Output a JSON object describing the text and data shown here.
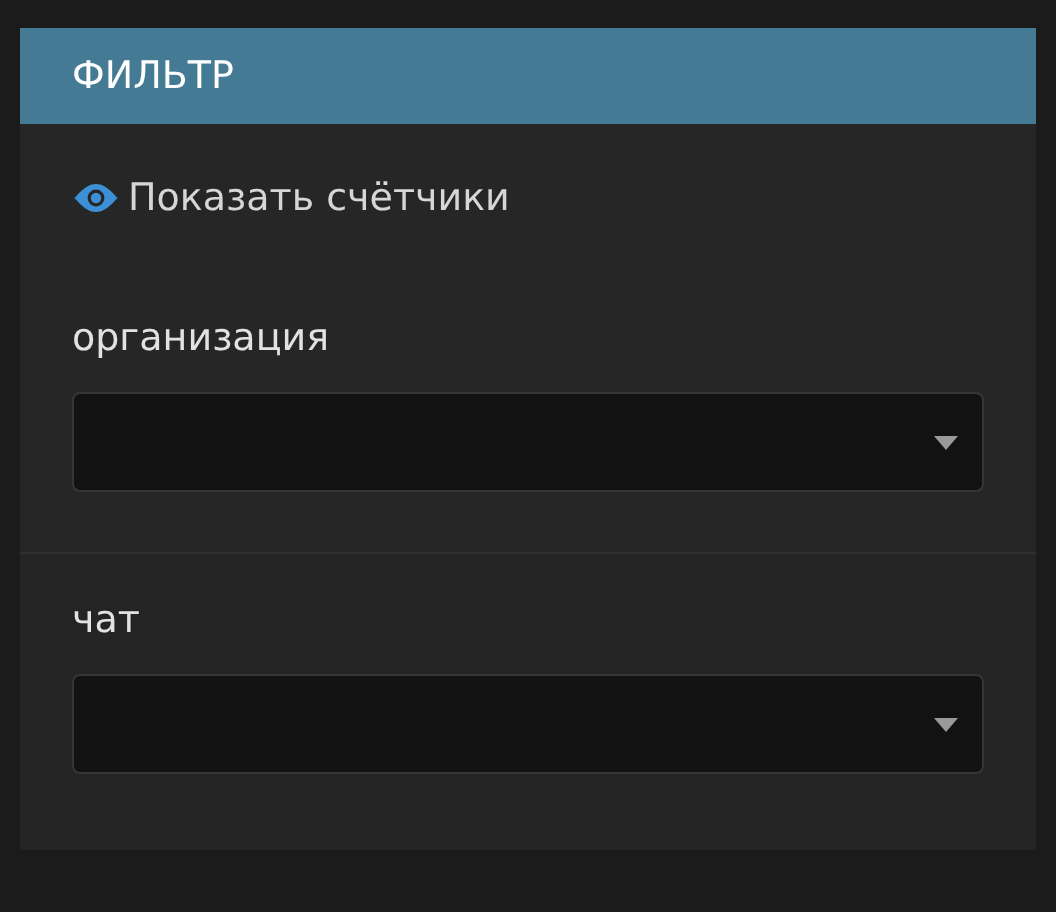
{
  "panel": {
    "title": "ФИЛЬТР"
  },
  "counters_link": {
    "label": "Показать счётчики"
  },
  "filters": [
    {
      "label": "организация"
    },
    {
      "label": "чат"
    }
  ]
}
